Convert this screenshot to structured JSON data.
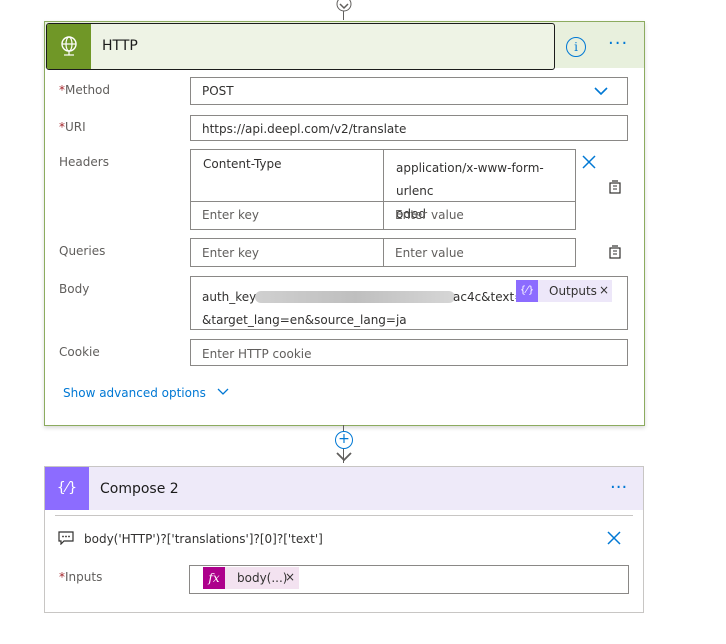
{
  "http_card": {
    "title": "HTTP",
    "info_icon_glyph": "i",
    "more_glyph": "···",
    "method": {
      "label": "Method",
      "required_mark": "*",
      "value": "POST"
    },
    "uri": {
      "label": "URI",
      "required_mark": "*",
      "value": "https://api.deepl.com/v2/translate"
    },
    "headers": {
      "label": "Headers",
      "rows": [
        {
          "key": "Content-Type",
          "value_line1": "application/x-www-form-urlenc",
          "value_line2": "oded"
        }
      ],
      "key_placeholder": "Enter key",
      "value_placeholder": "Enter value"
    },
    "queries": {
      "label": "Queries",
      "key_placeholder": "Enter key",
      "value_placeholder": "Enter value"
    },
    "body": {
      "label": "Body",
      "prefix": "auth_key=",
      "mid": "ac4c&text=",
      "token_label": "Outputs",
      "token_remove": "×",
      "line2": "&target_lang=en&source_lang=ja"
    },
    "cookie": {
      "label": "Cookie",
      "placeholder": "Enter HTTP cookie"
    },
    "advanced": "Show advanced options",
    "accent_color": "#709727"
  },
  "compose_card": {
    "title": "Compose 2",
    "more_glyph": "···",
    "expression": "body('HTTP')?['translations']?[0]?['text']",
    "inputs": {
      "label": "Inputs",
      "required_mark": "*",
      "token_label": "body(...)",
      "token_remove": "×",
      "fx_glyph": "fx"
    },
    "accent_color": "#8c6cff"
  }
}
